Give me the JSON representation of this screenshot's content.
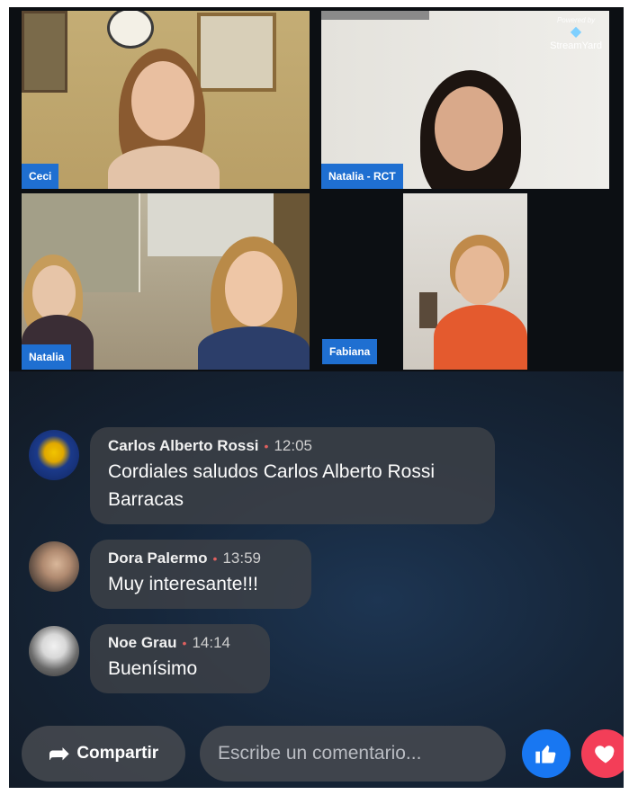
{
  "stream": {
    "tiles": [
      {
        "label": "Ceci"
      },
      {
        "label": "Natalia - RCT"
      },
      {
        "label": "Natalia"
      },
      {
        "label": "Fabiana"
      }
    ],
    "powered_by": {
      "line1": "Powered by",
      "line2": "StreamYard"
    }
  },
  "comments": [
    {
      "author": "Carlos Alberto Rossi",
      "time": "12:05",
      "text": "Cordiales saludos Carlos Alberto Rossi Barracas"
    },
    {
      "author": "Dora Palermo",
      "time": "13:59",
      "text": "Muy interesante!!!"
    },
    {
      "author": "Noe Grau",
      "time": "14:14",
      "text": "Buenísimo"
    }
  ],
  "bottom_bar": {
    "share_label": "Compartir",
    "comment_placeholder": "Escribe un comentario...",
    "like_icon": "thumbs-up-icon",
    "love_icon": "heart-icon"
  },
  "colors": {
    "label_blue": "#1f6fd1",
    "like_blue": "#1877f2",
    "love_red": "#f33e58",
    "separator_dot": "#e0605f"
  }
}
